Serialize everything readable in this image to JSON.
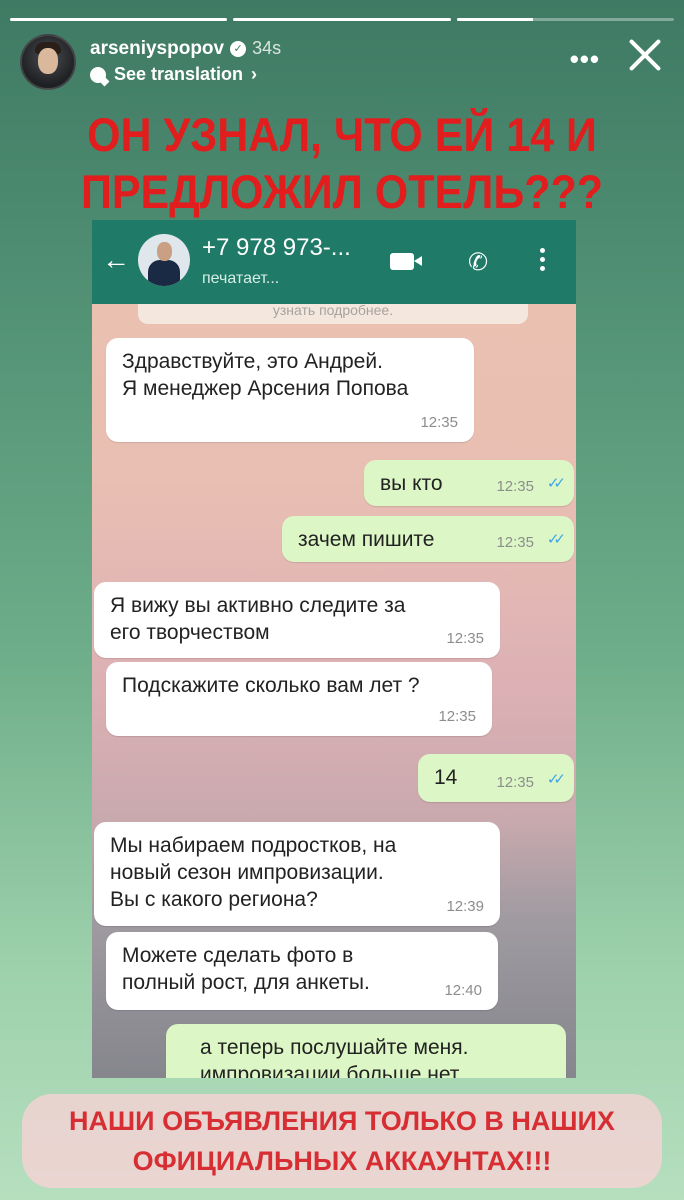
{
  "story": {
    "progress": [
      1,
      1,
      0.35
    ],
    "username": "arseniyspopov",
    "time_ago": "34s",
    "see_translation": "See translation",
    "headline": [
      "ОН УЗНАЛ, ЧТО ЕЙ 14 И",
      "ПРЕДЛОЖИЛ ОТЕЛЬ???"
    ],
    "footer": [
      "НАШИ ОБЪЯВЛЕНИЯ ТОЛЬКО В НАШИХ",
      "ОФИЦИАЛЬНЫХ АККАУНТАХ!!!"
    ],
    "colors": {
      "headline": "#e11d1d",
      "footer_text": "#d72e34",
      "whatsapp_bar": "#1f7a67"
    }
  },
  "chat": {
    "contact": "+7 978 973-...",
    "status": "печатает...",
    "clipped_top_text": "узнать подробнее.",
    "messages": [
      {
        "dir": "in",
        "lines": [
          "Здравствуйте, это Андрей.",
          "Я менеджер Арсения Попова"
        ],
        "time": "12:35"
      },
      {
        "dir": "out",
        "lines": [
          "вы кто"
        ],
        "time": "12:35"
      },
      {
        "dir": "out",
        "lines": [
          "зачем пишите"
        ],
        "time": "12:35"
      },
      {
        "dir": "in",
        "lines": [
          "Я вижу вы активно следите за",
          "его творчеством"
        ],
        "time": "12:35"
      },
      {
        "dir": "in",
        "lines": [
          "Подскажите сколько вам лет ?"
        ],
        "time": "12:35"
      },
      {
        "dir": "out",
        "lines": [
          "14"
        ],
        "time": "12:35"
      },
      {
        "dir": "in",
        "lines": [
          "Мы набираем подростков, на",
          "новый сезон импровизации.",
          "Вы с какого региона?"
        ],
        "time": "12:39"
      },
      {
        "dir": "in",
        "lines": [
          "Можете сделать фото в",
          "полный рост, для анкеты."
        ],
        "time": "12:40"
      },
      {
        "dir": "out",
        "lines": [
          "а теперь послушайте меня.",
          "импровизации больше нет"
        ],
        "time": ""
      }
    ]
  }
}
